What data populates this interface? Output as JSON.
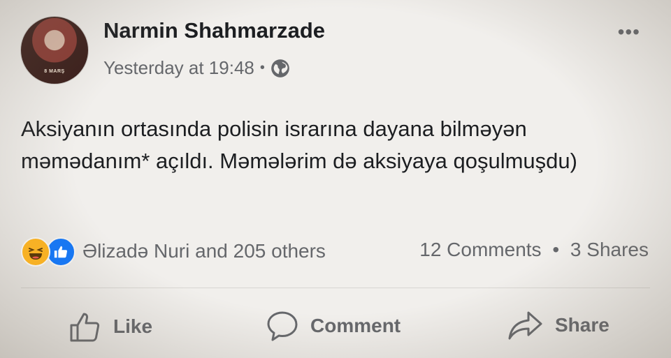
{
  "post": {
    "author": "Narmin Shahmarzade",
    "timestamp": "Yesterday at 19:48",
    "separator": "•",
    "privacy_icon": "globe-icon",
    "avatar_caption": "8 MARŞ",
    "more_label": "•••",
    "text": "Aksiyanın ortasında polisin israrına dayana bilməyən məmədanım* açıldı. Məmələrim də aksiyaya qoşulmuşdu)"
  },
  "stats": {
    "reaction_icons": [
      "haha-reaction-icon",
      "like-reaction-icon"
    ],
    "reactors": "Əlizadə Nuri and 205 others",
    "comments": "12 Comments",
    "dot": "•",
    "shares": "3 Shares"
  },
  "actions": {
    "like": "Like",
    "comment": "Comment",
    "share": "Share"
  },
  "colors": {
    "background": "#f1efec",
    "text": "#1c1e21",
    "muted": "#65676b",
    "like_blue": "#1877f2",
    "haha_yellow": "#f7b125"
  }
}
